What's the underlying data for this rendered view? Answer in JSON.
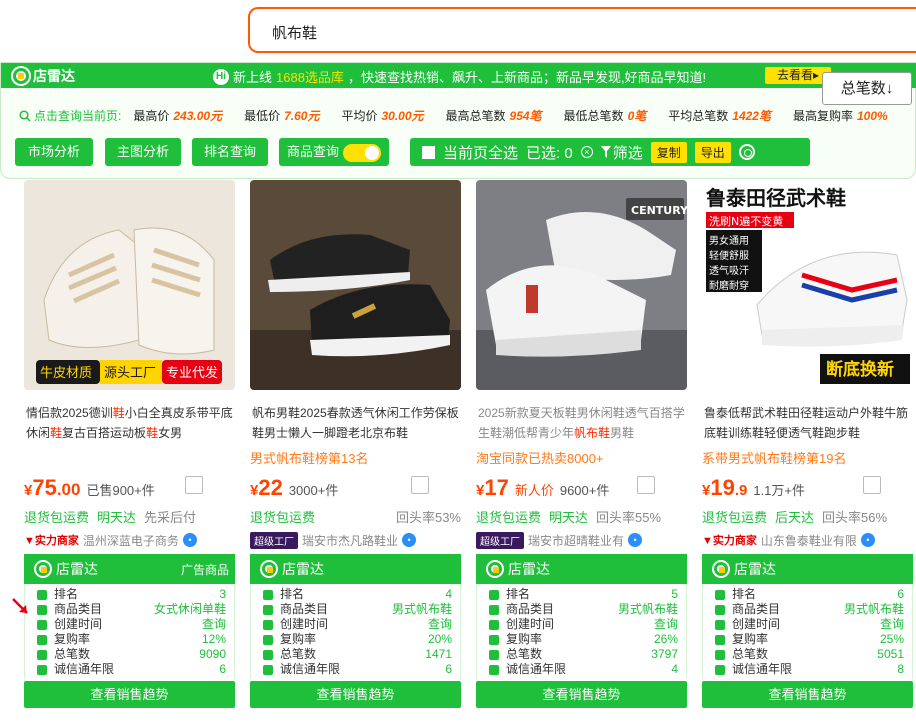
{
  "search": {
    "query": "帆布鞋"
  },
  "plugin": {
    "brand": "店雷达",
    "announcement_prefix": "新上线",
    "announcement_highlight": "1688选品库",
    "announcement_text": "，快速查找热销、飙升、上新商品；新品早发现,好商品早知道!",
    "look_button": "去看看▸",
    "hint": "点击查询当前页:",
    "stats": [
      {
        "label": "最高价",
        "value": "243.00元"
      },
      {
        "label": "最低价",
        "value": "7.60元"
      },
      {
        "label": "平均价",
        "value": "30.00元"
      },
      {
        "label": "最高总笔数",
        "value": "954笔"
      },
      {
        "label": "最低总笔数",
        "value": "0笔"
      },
      {
        "label": "平均总笔数",
        "value": "1422笔"
      },
      {
        "label": "最高复购率",
        "value": "100%"
      }
    ],
    "buttons": {
      "market": "市场分析",
      "mainimg": "主图分析",
      "rank": "排名查询",
      "product": "商品查询"
    },
    "toolbar": {
      "select_all": "当前页全选",
      "selected": "已选: 0",
      "filter": "筛选",
      "copy": "复制",
      "export": "导出"
    },
    "sort": "总笔数↓"
  },
  "products": [
    {
      "title_parts": [
        "情侣款2025德训",
        "鞋",
        "小白全真皮系带平底休闲",
        "鞋",
        "复古百搭运动板",
        "鞋",
        "女男"
      ],
      "rank_line": "",
      "price_int": "75",
      "price_dec": ".00",
      "extra_tag": "",
      "sold": "已售900+件",
      "services": [
        "退货包运费",
        "明天达",
        "先采后付"
      ],
      "badge": "实力商家",
      "shop": "温州深蓝电子商务",
      "dl_tag": "广告商品",
      "rank": "3",
      "category": "女式休闲单鞋",
      "create_time": "查询",
      "repurchase": "12%",
      "total": "9090",
      "years": "6",
      "thumb": {
        "bg": "#e6ded2",
        "label1": "牛皮材质",
        "label2": "源头工厂",
        "label3": "专业代发"
      }
    },
    {
      "title_parts": [
        "帆布男鞋2025春款透气休闲工作劳保板鞋男士懒人一脚蹬老北京布鞋"
      ],
      "rank_line": "男式帆布鞋榜第13名",
      "price_int": "22",
      "price_dec": "",
      "extra_tag": "",
      "sold": "3000+件",
      "services": [
        "退货包运费",
        "",
        "回头率53%"
      ],
      "badge": "超级工厂",
      "shop": "瑞安市杰凡路鞋业",
      "dl_tag": "",
      "rank": "4",
      "category": "男式帆布鞋",
      "create_time": "查询",
      "repurchase": "20%",
      "total": "1471",
      "years": "6",
      "thumb": {
        "bg": "#6b5a48"
      }
    },
    {
      "title_parts": [
        "2025新款夏天板鞋男休闲鞋透气百搭学生鞋潮低帮青少年",
        "帆布鞋",
        "男鞋"
      ],
      "rank_line": "淘宝同款已热卖8000+",
      "price_int": "17",
      "price_dec": "",
      "extra_tag": "新人价",
      "sold": "9600+件",
      "services": [
        "退货包运费",
        "明天达",
        "回头率55%"
      ],
      "badge": "超级工厂",
      "shop": "瑞安市超晴鞋业有",
      "dl_tag": "",
      "rank": "5",
      "category": "男式帆布鞋",
      "create_time": "查询",
      "repurchase": "26%",
      "total": "3797",
      "years": "4",
      "thumb": {
        "bg": "#7d7f84",
        "label1": "CENTURY"
      }
    },
    {
      "title_parts": [
        "鲁泰低帮武术鞋田径鞋运动户外鞋牛筋底鞋训练鞋轻便透气鞋跑步鞋"
      ],
      "rank_line": "系带男式帆布鞋榜第19名",
      "price_int": "19",
      "price_dec": ".9",
      "extra_tag": "",
      "sold": "1.1万+件",
      "services": [
        "退货包运费",
        "后天达",
        "回头率56%"
      ],
      "badge": "实力商家",
      "shop": "山东鲁泰鞋业有限",
      "dl_tag": "",
      "rank": "6",
      "category": "男式帆布鞋",
      "create_time": "查询",
      "repurchase": "25%",
      "total": "5051",
      "years": "8",
      "thumb": {
        "bg": "#ffffff",
        "label1": "鲁泰田径武术鞋",
        "label2": "洗刷N遍不变黄",
        "label3": "男女通用 轻便舒服 透气吸汗 耐磨耐穿",
        "label4": "断底换新"
      }
    }
  ],
  "dl_labels": {
    "rank": "排名",
    "category": "商品类目",
    "create_time": "创建时间",
    "repurchase": "复购率",
    "total": "总笔数",
    "years": "诚信通年限",
    "trend": "查看销售趋势"
  }
}
